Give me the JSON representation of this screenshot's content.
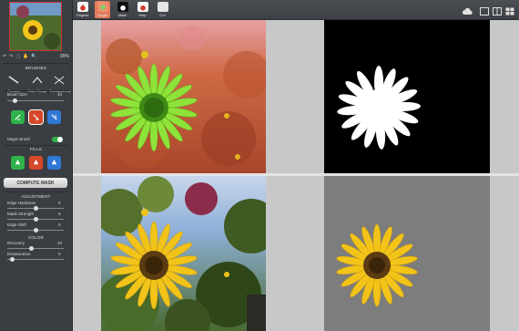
{
  "toolbar": {
    "tools": [
      {
        "label": "Original",
        "icon": "apple-icon",
        "color": "#d23a2c"
      },
      {
        "label": "Single",
        "icon": "split-icon",
        "color": "#e0704a"
      },
      {
        "label": "Mask",
        "icon": "mask-icon",
        "color": "#111111"
      },
      {
        "label": "Help",
        "icon": "help-icon",
        "color": "#d23a2c"
      },
      {
        "label": "Cut",
        "icon": "cut-icon",
        "color": "#dddddd"
      }
    ]
  },
  "sidebar": {
    "zoom": "99%",
    "brushes_title": "BRUSHES",
    "brush_types": [
      "Primary",
      "Color Range",
      "Transparency"
    ],
    "brush_size_label": "Brush Size",
    "brush_size_value": "10",
    "magic_brush_label": "Magic Brush",
    "fills_title": "FILLS",
    "compute_label": "COMPUTE MASK",
    "adjustment_title": "ADJUSTMENT",
    "adjustments": [
      {
        "label": "Edge Hardness",
        "value": "0"
      },
      {
        "label": "Mask Strength",
        "value": "0"
      },
      {
        "label": "Edge Shift",
        "value": "0"
      }
    ],
    "color_title": "COLOR",
    "colors": [
      {
        "label": "Recovery",
        "value": "40"
      },
      {
        "label": "Desaturation",
        "value": "0"
      }
    ]
  },
  "colors": {
    "accent_red": "#d6482a",
    "accent_green": "#2fb24a",
    "accent_blue": "#2f78d6",
    "workspace": "#c8c8c8"
  }
}
